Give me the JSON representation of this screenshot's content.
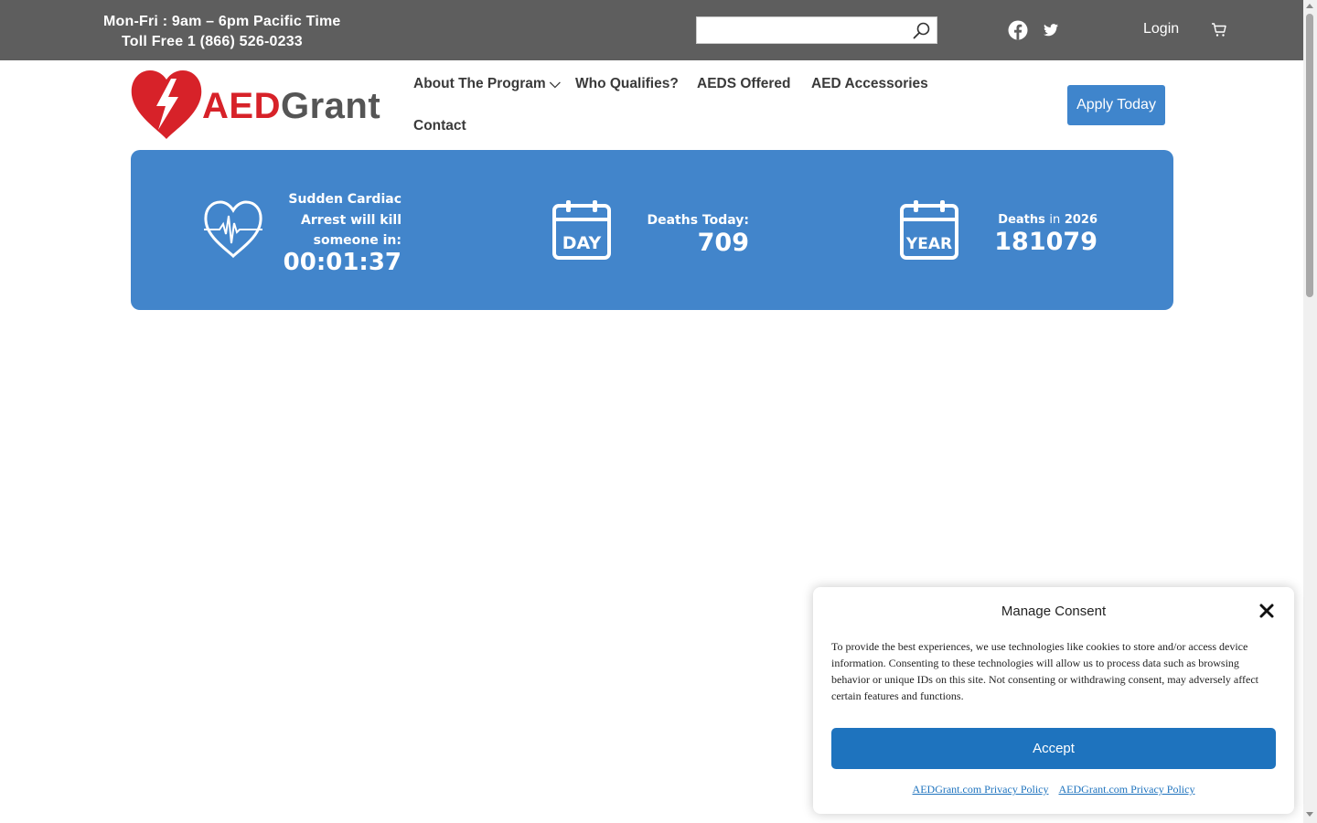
{
  "topbar": {
    "hours": "Mon-Fri : 9am – 6pm Pacific Time",
    "phone": "Toll Free 1 (866) 526-0233",
    "search_placeholder": "",
    "login_label": "Login"
  },
  "logo": {
    "aed": "AED",
    "grant": "Grant"
  },
  "nav": {
    "items": [
      {
        "label": "About The Program ⌵"
      },
      {
        "label": "Who Qualifies?"
      },
      {
        "label": "AEDS Offered"
      },
      {
        "label": "AED Accessories"
      },
      {
        "label": "Contact"
      }
    ],
    "apply_label": "Apply Today"
  },
  "stats": {
    "countdown": {
      "label_lines": [
        "Sudden Cardiac",
        "Arrest will kill",
        "someone in:"
      ],
      "value": "00:01:37"
    },
    "today": {
      "icon_text": "DAY",
      "label": "Deaths Today:",
      "value": "709"
    },
    "year": {
      "icon_text": "YEAR",
      "label_prefix": "Deaths",
      "label_in": "in",
      "year": "2026",
      "value": "181079"
    }
  },
  "consent": {
    "title": "Manage Consent",
    "text": "To provide the best experiences, we use technologies like cookies to store and/or access device information. Consenting to these technologies will allow us to process data such as browsing behavior or unique IDs on this site. Not consenting or withdrawing consent, may adversely affect certain features and functions.",
    "accept_label": "Accept",
    "links": [
      "AEDGrant.com Privacy Policy",
      "AEDGrant.com Privacy Policy"
    ]
  },
  "colors": {
    "topbar": "#5e5e5e",
    "accent_blue": "#4285cb",
    "logo_red": "#d72229",
    "accept_blue": "#1e73be"
  }
}
